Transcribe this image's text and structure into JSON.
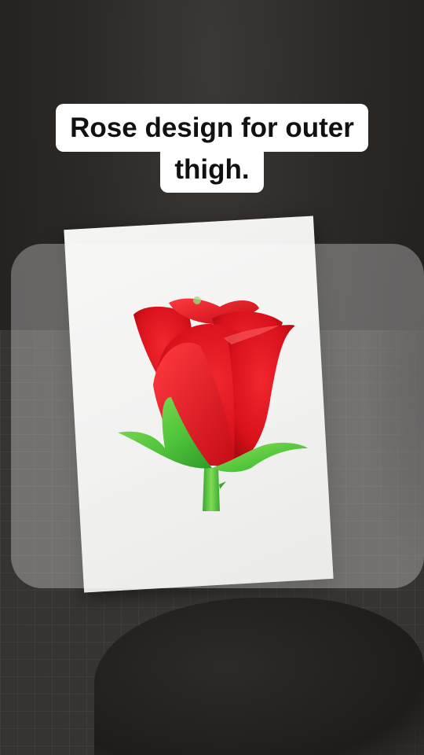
{
  "caption": {
    "line1": "Rose design for outer",
    "line2": "thigh."
  },
  "colors": {
    "caption_background": "#ffffff",
    "caption_text": "#111111",
    "petal_red": "#e0141f",
    "leaf_green": "#4fc43a",
    "paper": "#eeeeec"
  },
  "icons": {
    "drawing": "rose-icon"
  }
}
